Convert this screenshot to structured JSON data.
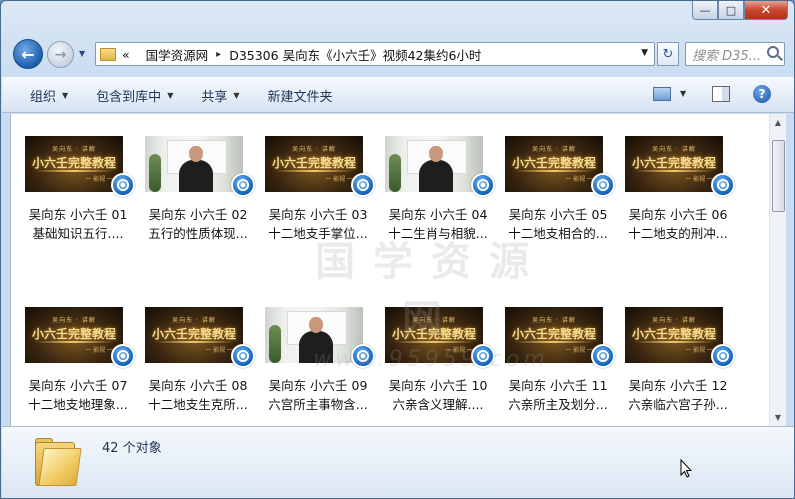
{
  "window": {
    "caption": {
      "minimize": "—",
      "maximize": "□",
      "close": "✕"
    }
  },
  "nav": {
    "back_icon": "←",
    "forward_icon": "→",
    "history_icon": "▼",
    "breadcrumb_overflow": "«",
    "breadcrumbs": [
      "国学资源网",
      "D35306 吴向东《小六壬》视频42集约6小时"
    ],
    "breadcrumb_sep": "▸",
    "dropdown_icon": "▼",
    "refresh_icon": "↻",
    "search_placeholder": "搜索 D35..."
  },
  "toolbar": {
    "organize": "组织",
    "include_in_library": "包含到库中",
    "share": "共享",
    "new_folder": "新建文件夹",
    "caret": "▼",
    "help": "?"
  },
  "thumbnail_card": {
    "top": "吴向东 · 讲解",
    "main": "小六壬完整教程",
    "sub": "一 影视 一"
  },
  "files": [
    {
      "line1": "吴向东 小六壬 01",
      "line2": "基础知识五行....",
      "thumb": "title"
    },
    {
      "line1": "吴向东 小六壬 02",
      "line2": "五行的性质体现...",
      "thumb": "video"
    },
    {
      "line1": "吴向东 小六壬 03",
      "line2": "十二地支手掌位...",
      "thumb": "title"
    },
    {
      "line1": "吴向东 小六壬 04",
      "line2": "十二生肖与相貌...",
      "thumb": "video"
    },
    {
      "line1": "吴向东 小六壬 05",
      "line2": "十二地支相合的...",
      "thumb": "title"
    },
    {
      "line1": "吴向东 小六壬 06",
      "line2": "十二地支的刑冲...",
      "thumb": "title"
    },
    {
      "line1": "吴向东 小六壬 07",
      "line2": "十二地支地理象...",
      "thumb": "title"
    },
    {
      "line1": "吴向东 小六壬 08",
      "line2": "十二地支生克所...",
      "thumb": "title"
    },
    {
      "line1": "吴向东 小六壬 09",
      "line2": "六宫所主事物含...",
      "thumb": "video"
    },
    {
      "line1": "吴向东 小六壬 10",
      "line2": "六亲含义理解....",
      "thumb": "title"
    },
    {
      "line1": "吴向东 小六壬 11",
      "line2": "六亲所主及划分...",
      "thumb": "title"
    },
    {
      "line1": "吴向东 小六壬 12",
      "line2": "六亲临六宫子孙...",
      "thumb": "title"
    }
  ],
  "watermark": {
    "main": "国学资源网",
    "url": "www.95959.com"
  },
  "scrollbar": {
    "up": "▲",
    "down": "▼"
  },
  "details": {
    "object_count": "42 个对象"
  },
  "colors": {
    "window_frame": "#4a6b91",
    "accent": "#1d5ea9",
    "close": "#c7472d"
  }
}
